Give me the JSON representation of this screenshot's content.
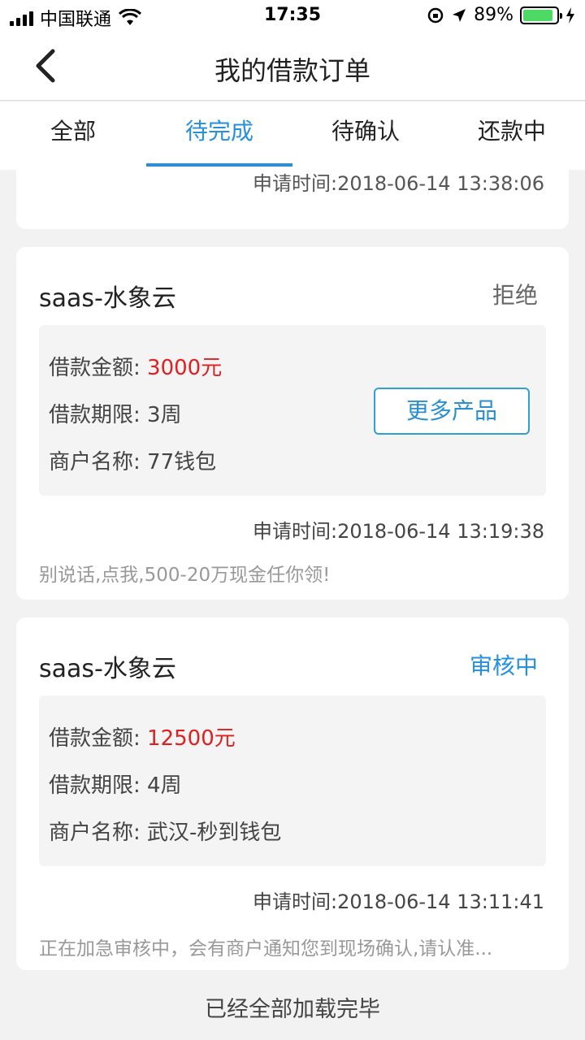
{
  "status_bar": {
    "carrier": "中国联通",
    "time": "17:35",
    "battery_percent": "89%",
    "battery_level": 0.89,
    "icons": [
      "signal-icon",
      "wifi-icon",
      "rotation-lock-icon",
      "location-icon",
      "battery-icon",
      "charging-icon"
    ]
  },
  "nav": {
    "title": "我的借款订单",
    "back_icon": "chevron-left-icon"
  },
  "tabs": [
    {
      "label": "全部",
      "active": false
    },
    {
      "label": "待完成",
      "active": true
    },
    {
      "label": "待确认",
      "active": false
    },
    {
      "label": "还款中",
      "active": false
    }
  ],
  "partial_card": {
    "time": "申请时间:2018-06-14 13:38:06"
  },
  "orders": [
    {
      "name": "saas-水象云",
      "status": "拒绝",
      "amount_label": "借款金额: ",
      "amount": "3000元",
      "term_label": "借款期限: ",
      "term": "3周",
      "merchant_label": "商户名称: ",
      "merchant": "77钱包",
      "button": "更多产品",
      "time": "申请时间:2018-06-14 13:19:38",
      "note": "别说话,点我,500-20万现金任你领!"
    },
    {
      "name": "saas-水象云",
      "status": "审核中",
      "amount_label": "借款金额: ",
      "amount": "12500元",
      "term_label": "借款期限: ",
      "term": "4周",
      "merchant_label": "商户名称: ",
      "merchant": "武汉-秒到钱包",
      "time": "申请时间:2018-06-14 13:11:41",
      "note": "正在加急审核中，会有商户通知您到现场确认,请认准..."
    }
  ],
  "footer": "已经全部加载完毕",
  "colors": {
    "accent": "#2490df",
    "amount_red": "#e02020",
    "background": "#f2f2f2"
  }
}
